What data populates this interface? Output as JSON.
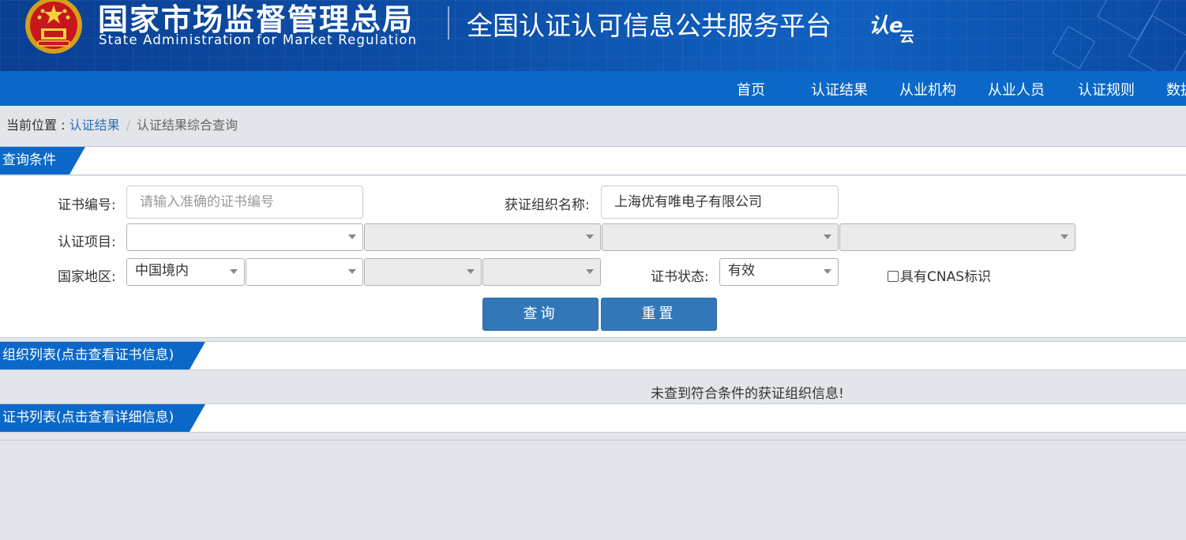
{
  "header": {
    "agency_name_cn": "国家市场监督管理总局",
    "agency_name_en": "State Administration  for  Market Regulation",
    "platform_title": "全国认证认可信息公共服务平台",
    "logo_text_main": "认e",
    "logo_text_sub": "云",
    "emblem_icon": "national-emblem-icon"
  },
  "nav": {
    "items": [
      "首页",
      "认证结果",
      "从业机构",
      "从业人员",
      "认证规则",
      "数据"
    ]
  },
  "breadcrumb": {
    "prefix": "当前位置 : ",
    "link": "认证结果",
    "separator": "/",
    "current": "认证结果综合查询"
  },
  "query_panel": {
    "title": "查询条件",
    "cert_no_label": "证书编号:",
    "cert_no_placeholder": "请输入准确的证书编号",
    "org_name_label": "获证组织名称:",
    "org_name_value": "上海优有唯电子有限公司",
    "project_label": "认证项目:",
    "project_selects": [
      "",
      "",
      "",
      ""
    ],
    "region_label": "国家地区:",
    "region_selects": [
      "中国境内",
      "",
      "",
      ""
    ],
    "status_label": "证书状态:",
    "status_value": "有效",
    "cnas_label": "具有CNAS标识",
    "cnas_checked": false,
    "search_button": "查询",
    "reset_button": "重置"
  },
  "org_panel": {
    "title": "组织列表(点击查看证书信息)",
    "empty_message": "未查到符合条件的获证组织信息!"
  },
  "cert_panel": {
    "title": "证书列表(点击查看详细信息)"
  },
  "colors": {
    "primary_blue": "#0b68c8",
    "button_blue": "#3278b8",
    "page_bg": "#e2e5ea"
  }
}
